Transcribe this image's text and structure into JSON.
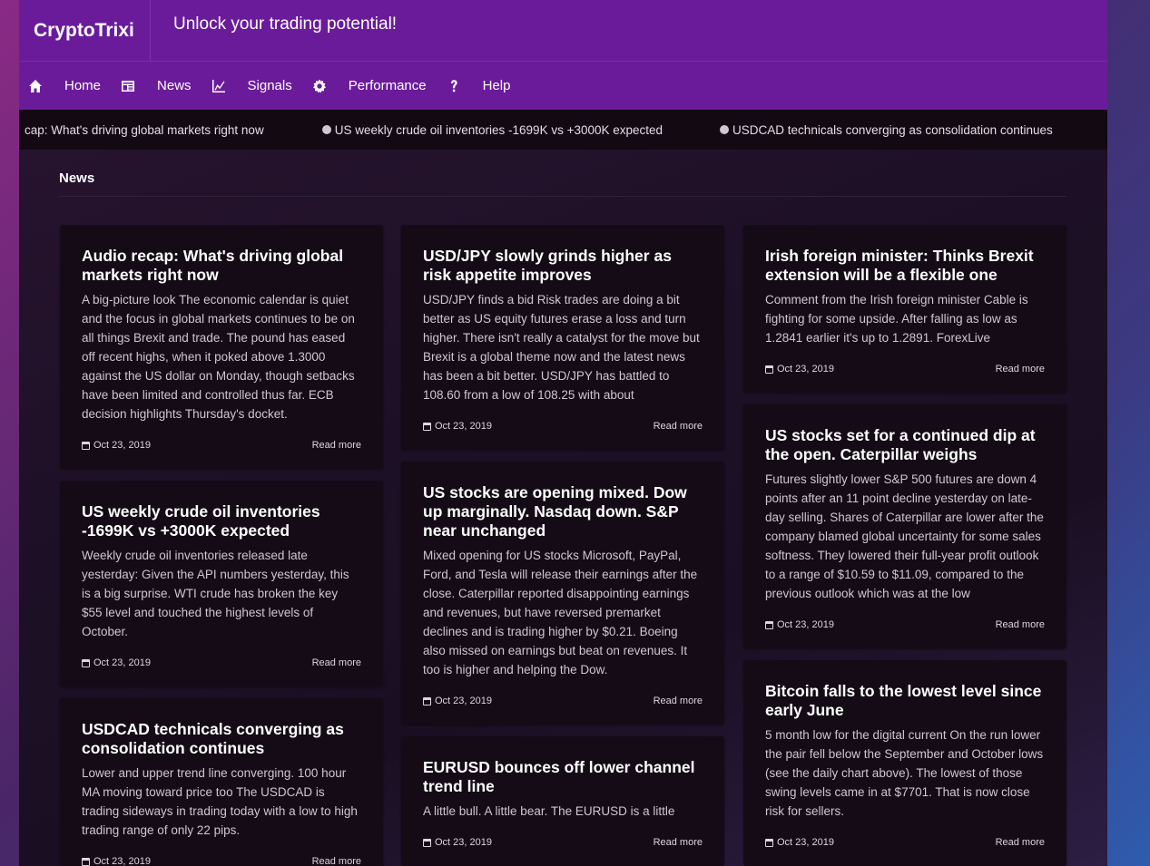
{
  "brand": "CryptoTrixi",
  "tagline": "Unlock your trading potential!",
  "nav": [
    {
      "icon": "home-icon",
      "label": "Home"
    },
    {
      "icon": "newspaper-icon",
      "label": "News"
    },
    {
      "icon": "chart-icon",
      "label": "Signals"
    },
    {
      "icon": "gear-icon",
      "label": "Performance"
    },
    {
      "icon": "question-icon",
      "label": "Help"
    }
  ],
  "ticker": [
    "cap: What's driving global markets right now",
    "US weekly crude oil inventories -1699K vs +3000K expected",
    "USDCAD technicals converging as consolidation continues"
  ],
  "section_title": "News",
  "read_more": "Read more",
  "columns": [
    [
      {
        "title": "Audio recap: What's driving global markets right now",
        "body": "A big-picture look The economic calendar is quiet and the focus in global markets continues to be on all things Brexit and trade. The pound has eased off recent highs, when it poked above 1.3000 against the US dollar on Monday, though setbacks have been limited and controlled thus far. ECB decision highlights Thursday's docket.",
        "date": "Oct 23, 2019"
      },
      {
        "title": "US weekly crude oil inventories -1699K vs +3000K expected",
        "body": "Weekly crude oil inventories released late yesterday: Given the API numbers yesterday, this is a big surprise. WTI crude has broken the key $55 level and touched the highest levels of October.",
        "date": "Oct 23, 2019"
      },
      {
        "title": "USDCAD technicals converging as consolidation continues",
        "body": "Lower and upper trend line converging.  100 hour MA moving toward price too The USDCAD is trading sideways in trading today with a low to high trading range of only 22 pips.",
        "date": "Oct 23, 2019"
      }
    ],
    [
      {
        "title": "USD/JPY slowly grinds higher as risk appetite improves",
        "body": "USD/JPY finds a bid Risk trades are doing a bit better as US equity futures erase a loss and turn higher. There isn't really a catalyst for the move but Brexit is a global theme now and the latest news has been a bit better. USD/JPY has battled to 108.60 from a low of 108.25 with about",
        "date": "Oct 23, 2019"
      },
      {
        "title": "US stocks are opening mixed. Dow up marginally. Nasdaq down. S&P near unchanged",
        "body": "Mixed opening for US stocks Microsoft, PayPal, Ford, and Tesla will release their earnings after the close.  Caterpillar reported disappointing earnings and revenues, but have reversed premarket declines and is trading higher by $0.21. Boeing also missed on earnings but beat on revenues. It too is higher and helping the Dow.",
        "date": "Oct 23, 2019"
      },
      {
        "title": "EURUSD bounces off lower channel trend line",
        "body": "A little bull. A little bear.  The EURUSD is a little",
        "date": "Oct 23, 2019"
      }
    ],
    [
      {
        "title": "Irish foreign minister: Thinks Brexit extension will be a flexible one",
        "body": "Comment from the Irish foreign minister Cable is fighting for some upside. After falling as low as 1.2841 earlier it's up to 1.2891. ForexLive",
        "date": "Oct 23, 2019"
      },
      {
        "title": "US stocks set for a continued dip at the open. Caterpillar weighs",
        "body": "Futures slightly lower S&P 500 futures are down 4 points after an 11 point decline yesterday on late-day selling. Shares of Caterpillar are lower after the company blamed global uncertainty for some sales softness. They lowered their full-year profit outlook to a range of $10.59 to $11.09, compared to the previous outlook which was at the low",
        "date": "Oct 23, 2019"
      },
      {
        "title": "Bitcoin falls to the lowest level since early June",
        "body": "5 month low for the digital current  On the run lower the pair fell below the September and October lows (see the daily chart above). The lowest of those swing levels came in at $7701. That is now close risk for sellers.",
        "date": "Oct 23, 2019"
      }
    ]
  ]
}
